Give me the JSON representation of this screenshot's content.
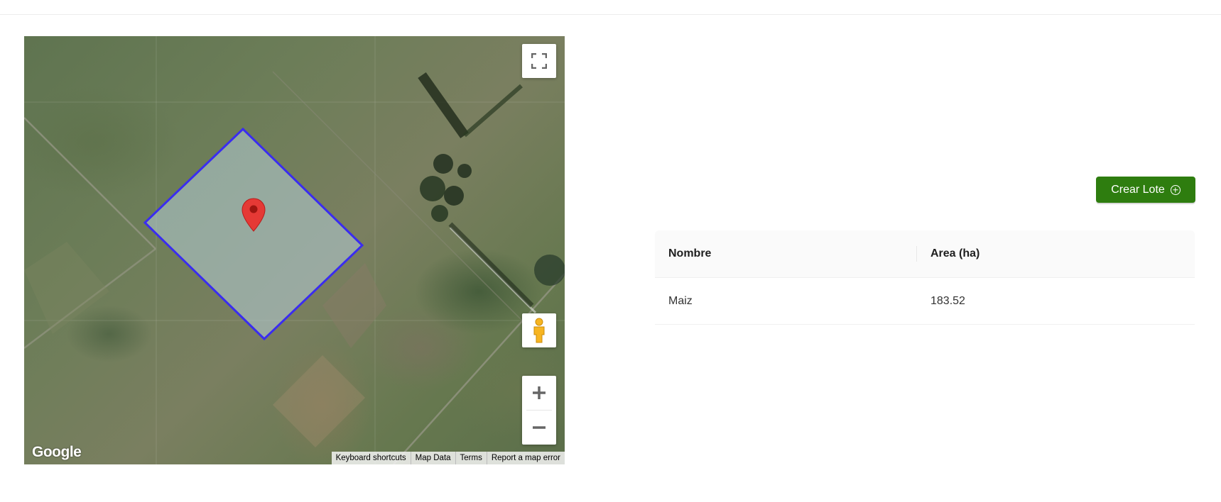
{
  "map": {
    "attribution_logo": "Google",
    "footer_links": [
      "Keyboard shortcuts",
      "Map Data",
      "Terms",
      "Report a map error"
    ],
    "controls": {
      "fullscreen": "fullscreen-icon",
      "street_view": "pegman-icon",
      "zoom_in": "plus-icon",
      "zoom_out": "minus-icon"
    },
    "polygon_color": "#3a2cf0",
    "marker_color": "#e53935"
  },
  "actions": {
    "create_label": "Crear Lote",
    "create_icon": "plus-circle-icon",
    "create_color": "#2e7d0f"
  },
  "table": {
    "columns": [
      "Nombre",
      "Area (ha)"
    ],
    "rows": [
      [
        "Maiz",
        "183.52"
      ]
    ]
  }
}
